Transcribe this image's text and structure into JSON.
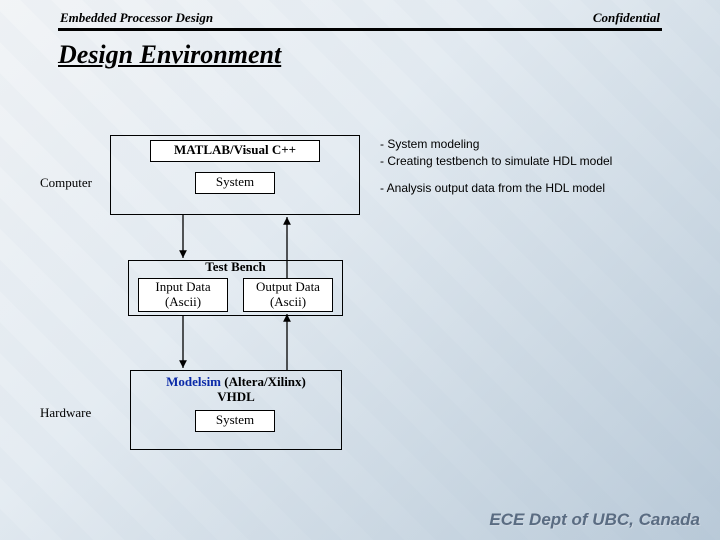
{
  "header": {
    "left": "Embedded Processor Design",
    "right": "Confidential"
  },
  "title": "Design Environment",
  "labels": {
    "computer": "Computer",
    "hardware": "Hardware",
    "matlab": "MATLAB/Visual C++",
    "system": "System",
    "testbench": "Test Bench",
    "inputdata_l1": "Input Data",
    "inputdata_l2": "(Ascii)",
    "outputdata_l1": "Output Data",
    "outputdata_l2": "(Ascii)",
    "modelsim_l1": "Modelsim",
    "modelsim_l2": " (Altera/Xilinx)",
    "vhdl": "VHDL",
    "system2": "System"
  },
  "annotations": {
    "top": "- System modeling\n- Creating testbench to simulate HDL model",
    "mid": "- Analysis output data from the HDL model"
  },
  "footer": "ECE Dept of UBC, Canada"
}
